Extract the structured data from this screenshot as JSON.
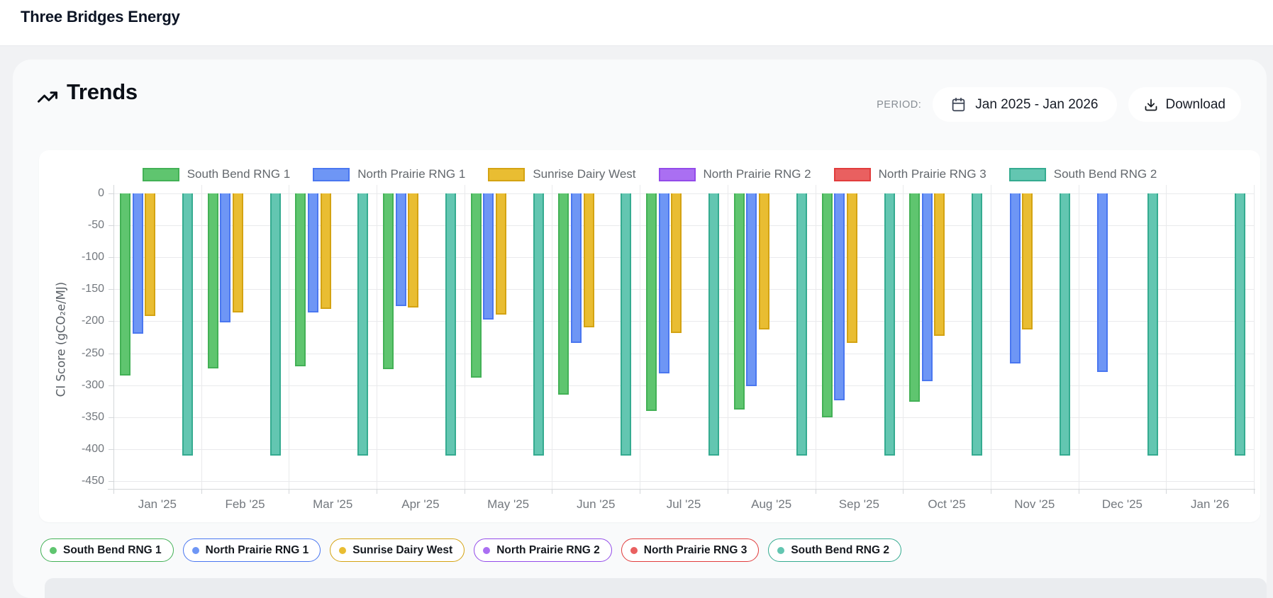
{
  "header": {
    "title": "Three Bridges Energy"
  },
  "trends": {
    "title": "Trends",
    "title_icon": "trending-up-icon",
    "period_label": "PERIOD:",
    "period_icon": "calendar-icon",
    "period_value": "Jan 2025 - Jan 2026",
    "download_icon": "download-icon",
    "download_label": "Download"
  },
  "chart_data": {
    "type": "bar",
    "title": "",
    "xlabel": "",
    "ylabel": "CI Score (gCO₂e/MJ)",
    "ylim": [
      0,
      -450
    ],
    "ytick_step": 50,
    "yticks": [
      0,
      -50,
      -100,
      -150,
      -200,
      -250,
      -300,
      -350,
      -400,
      -450
    ],
    "grid": true,
    "legend_position": "top-center and bottom-left pills",
    "categories": [
      "Jan '25",
      "Feb '25",
      "Mar '25",
      "Apr '25",
      "May '25",
      "Jun '25",
      "Jul '25",
      "Aug '25",
      "Sep '25",
      "Oct '25",
      "Nov '25",
      "Dec '25",
      "Jan '26"
    ],
    "series": [
      {
        "name": "South Bend RNG 1",
        "color": "#5fc56f",
        "border": "#43b156",
        "values": [
          -285,
          -274,
          -270,
          -275,
          -288,
          -315,
          -340,
          -338,
          -350,
          -326,
          null,
          null,
          null
        ]
      },
      {
        "name": "North Prairie RNG 1",
        "color": "#6e96f5",
        "border": "#4a77f0",
        "values": [
          -219,
          -202,
          -186,
          -176,
          -197,
          -234,
          -282,
          -302,
          -324,
          -294,
          -266,
          -279,
          null
        ]
      },
      {
        "name": "Sunrise Dairy West",
        "color": "#e9bd32",
        "border": "#d4a312",
        "values": [
          -192,
          -186,
          -181,
          -178,
          -190,
          -210,
          -218,
          -213,
          -234,
          -223,
          -213,
          null,
          null
        ]
      },
      {
        "name": "North Prairie RNG 2",
        "color": "#aa6ff2",
        "border": "#934be9",
        "values": [
          null,
          null,
          null,
          null,
          null,
          null,
          null,
          null,
          null,
          null,
          null,
          null,
          null
        ]
      },
      {
        "name": "North Prairie RNG 3",
        "color": "#e96060",
        "border": "#e13d3d",
        "values": [
          null,
          null,
          null,
          null,
          null,
          null,
          null,
          null,
          null,
          null,
          null,
          null,
          null
        ]
      },
      {
        "name": "South Bend RNG 2",
        "color": "#63c6b1",
        "border": "#35ab90",
        "values": [
          -410,
          -410,
          -410,
          -410,
          -410,
          -410,
          -410,
          -410,
          -410,
          -410,
          -410,
          -410,
          -410
        ]
      }
    ]
  }
}
